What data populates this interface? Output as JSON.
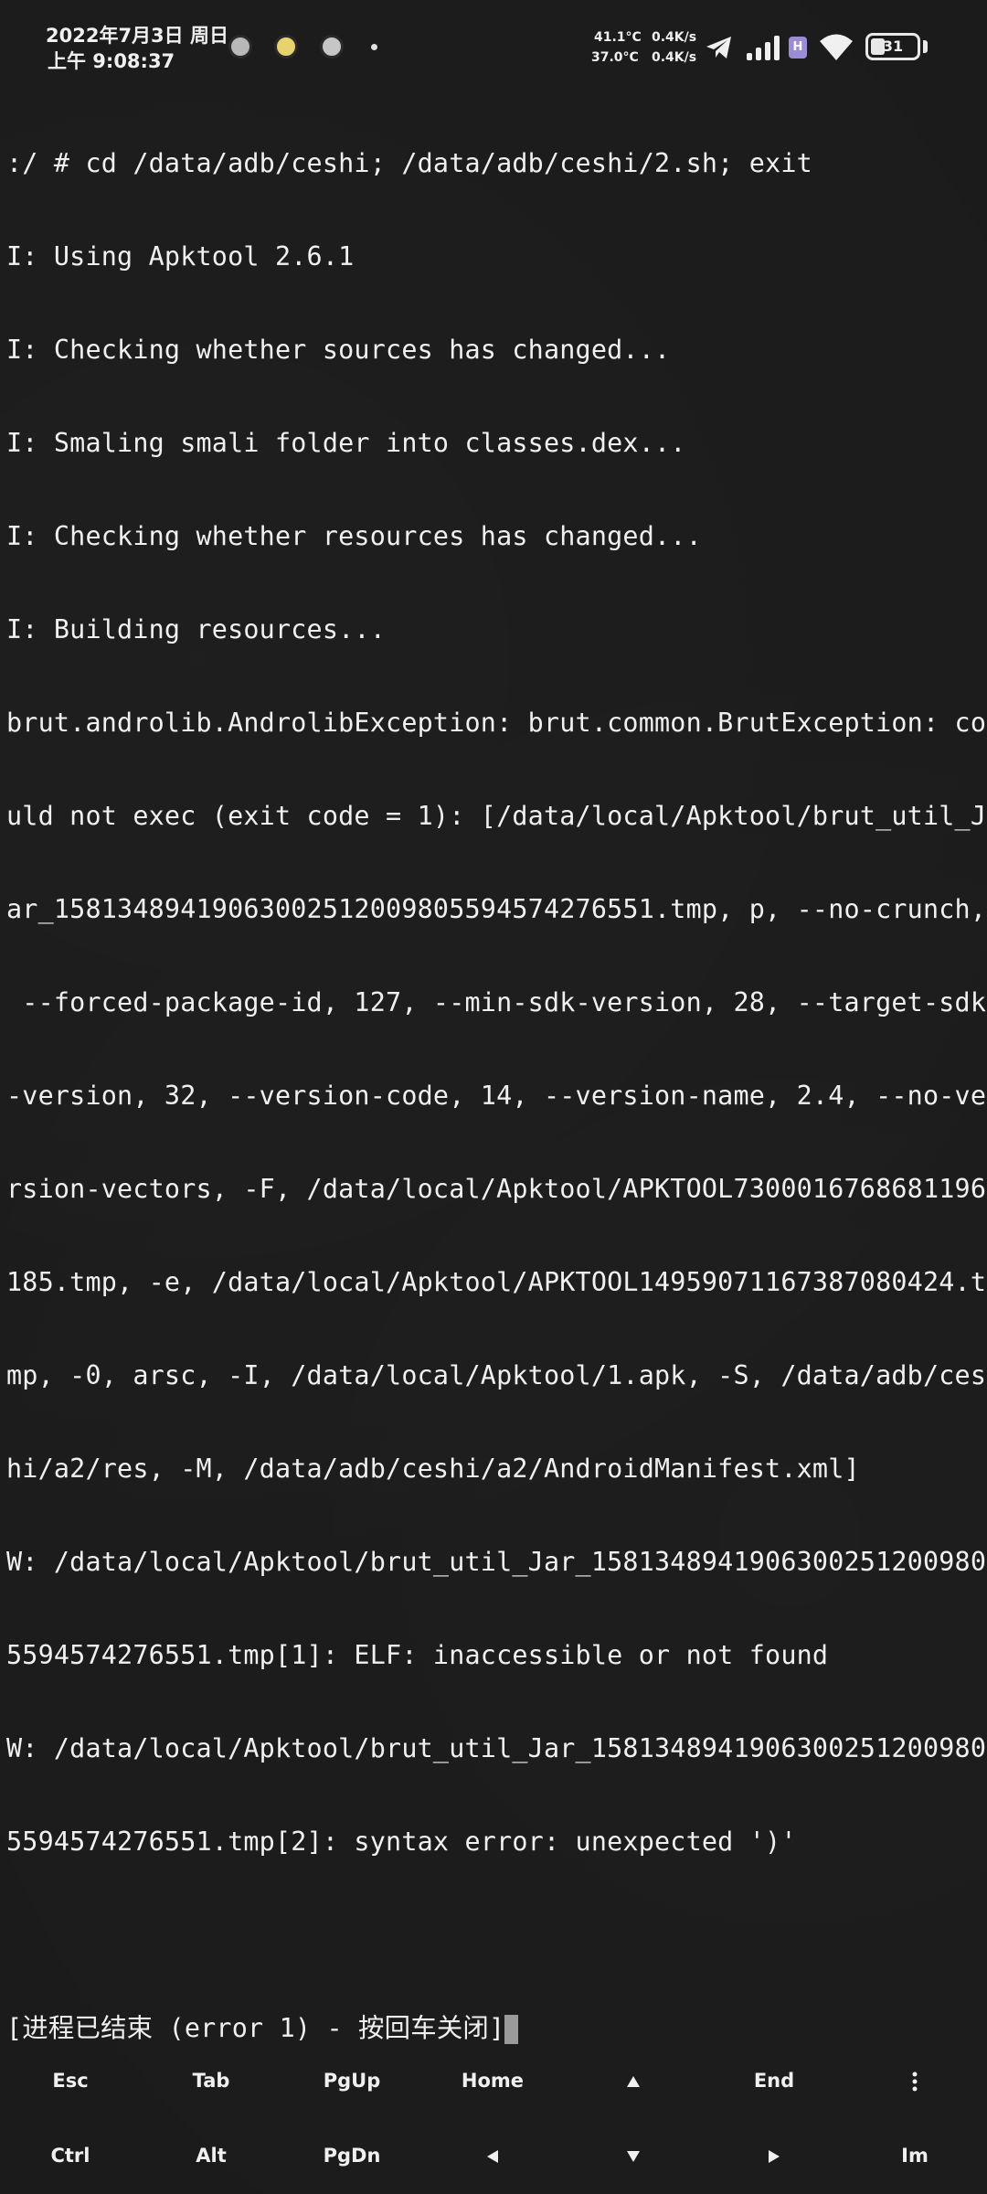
{
  "status_bar": {
    "date": "2022年7月3日 周日",
    "time": "上午 9:08:37",
    "notification_icons": [
      "app-icon-1",
      "app-icon-2",
      "app-icon-3"
    ],
    "temp_line1": "41.1°C",
    "temp_line2": "37.0°C",
    "net_speed_up": "0.4K/s",
    "net_speed_down": "0.4K/s",
    "hd_label": "H",
    "battery_level": "31",
    "battery_fraction": 0.31
  },
  "terminal": {
    "lines": [
      ":/ # cd /data/adb/ceshi; /data/adb/ceshi/2.sh; exit",
      "I: Using Apktool 2.6.1",
      "I: Checking whether sources has changed...",
      "I: Smaling smali folder into classes.dex...",
      "I: Checking whether resources has changed...",
      "I: Building resources...",
      "brut.androlib.AndrolibException: brut.common.BrutException: co",
      "uld not exec (exit code = 1): [/data/local/Apktool/brut_util_J",
      "ar_15813489419063002512009805594574276551.tmp, p, --no-crunch,",
      " --forced-package-id, 127, --min-sdk-version, 28, --target-sdk",
      "-version, 32, --version-code, 14, --version-name, 2.4, --no-ve",
      "rsion-vectors, -F, /data/local/Apktool/APKTOOL7300016768681196",
      "185.tmp, -e, /data/local/Apktool/APKTOOL1495907116738708042​4.t",
      "mp, -0, arsc, -I, /data/local/Apktool/1.apk, -S, /data/adb/ces",
      "hi/a2/res, -M, /data/adb/ceshi/a2/AndroidManifest.xml]",
      "W: /data/local/Apktool/brut_util_Jar_158134894190630025120098​0",
      "5594574276551.tmp[1]: ELF: inaccessible or not found",
      "W: /data/local/Apktool/brut_util_Jar_158134894190630025120098​0",
      "5594574276551.tmp[2]: syntax error: unexpected ')'"
    ],
    "exit_message": "[进程已结束 (error 1) - 按回车关闭]"
  },
  "extra_keys": {
    "row1": [
      "Esc",
      "Tab",
      "PgUp",
      "Home",
      "up-arrow",
      "End",
      "more"
    ],
    "row2": [
      "Ctrl",
      "Alt",
      "PgDn",
      "left-arrow",
      "down-arrow",
      "right-arrow",
      "Im"
    ],
    "labels": {
      "esc": "Esc",
      "tab": "Tab",
      "pgup": "PgUp",
      "home": "Home",
      "end": "End",
      "ctrl": "Ctrl",
      "alt": "Alt",
      "pgdn": "PgDn",
      "im": "Im"
    }
  }
}
